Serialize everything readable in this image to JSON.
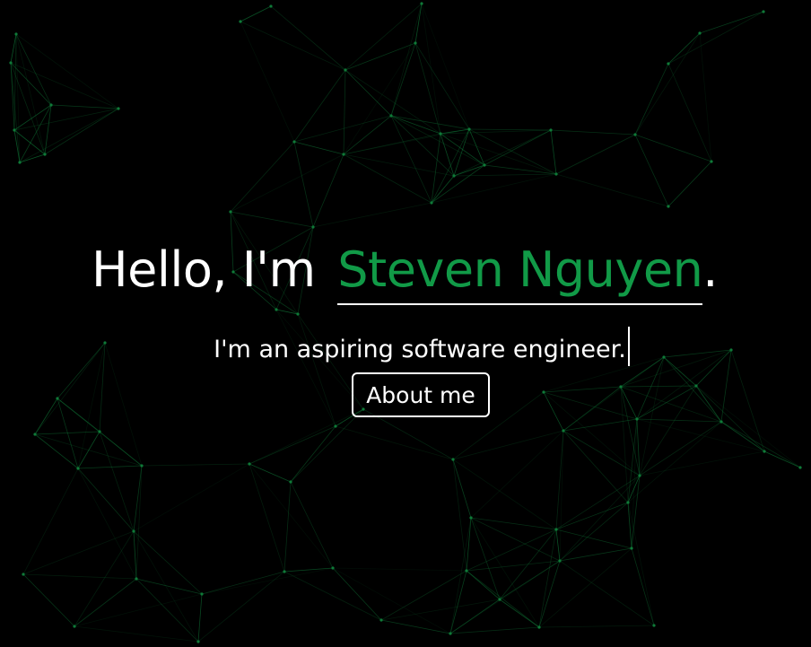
{
  "hero": {
    "greeting": "Hello, I'm",
    "name": "Steven Nguyen",
    "period": ".",
    "tagline": "I'm an aspiring software engineer.",
    "button_label": "About me"
  },
  "colors": {
    "background": "#000000",
    "accent": "#119a47",
    "text": "#ffffff",
    "network_line": "#0f7a38"
  }
}
